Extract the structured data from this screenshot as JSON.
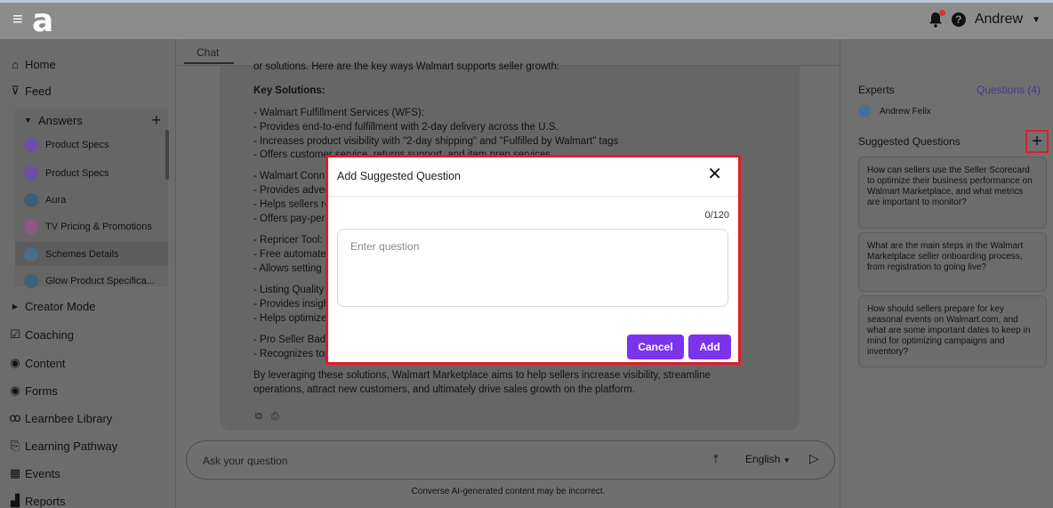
{
  "header": {
    "logo": "a",
    "user_name": "Andrew"
  },
  "sidebar": {
    "items": [
      {
        "label": "Home",
        "icon": "home-icon"
      },
      {
        "label": "Feed",
        "icon": "feed-icon"
      }
    ],
    "answers": {
      "label": "Answers",
      "items": [
        {
          "label": "Product Specs"
        },
        {
          "label": "Product Specs"
        },
        {
          "label": "Aura"
        },
        {
          "label": "TV Pricing & Promotions"
        },
        {
          "label": "Schemes Details"
        },
        {
          "label": "Glow Product Specifica..."
        }
      ]
    },
    "lower_items": [
      {
        "label": "Creator Mode",
        "icon": "caret-right-icon"
      },
      {
        "label": "Coaching",
        "icon": "checkbox-icon"
      },
      {
        "label": "Content",
        "icon": "content-icon"
      },
      {
        "label": "Forms",
        "icon": "forms-icon"
      },
      {
        "label": "Learnbee Library",
        "icon": "library-icon"
      },
      {
        "label": "Learning Pathway",
        "icon": "pathway-icon"
      },
      {
        "label": "Events",
        "icon": "calendar-icon"
      },
      {
        "label": "Reports",
        "icon": "reports-icon"
      }
    ]
  },
  "chat": {
    "tab_label": "Chat",
    "lines": [
      "or solutions. Here are the key ways Walmart supports seller growth:",
      "Key Solutions:",
      "- Walmart Fulfillment Services (WFS):",
      "- Provides end-to-end fulfillment with 2-day delivery across the U.S.",
      "- Increases product visibility with \"2-day shipping\" and \"Fulfilled by Walmart\" tags",
      "- Offers customer service, returns support, and item prep services",
      "- Walmart Conn",
      "- Provides adver",
      "- Helps sellers re",
      "- Offers pay-per-",
      "- Repricer Tool:",
      "- Free automate",
      "- Allows setting",
      "- Listing Quality",
      "- Provides insigh",
      "- Helps optimize",
      "- Pro Seller Badg",
      "- Recognizes top",
      "By leveraging these solutions, Walmart Marketplace aims to help sellers increase visibility, streamline",
      "operations, attract new customers, and ultimately drive sales growth on the platform."
    ],
    "ask_placeholder": "Ask your question",
    "language": "English",
    "disclaimer": "Converse AI-generated content may be incorrect."
  },
  "right_panel": {
    "experts_label": "Experts",
    "questions_link": "Questions (4)",
    "expert_name": "Andrew Felix",
    "suggested_label": "Suggested Questions",
    "questions": [
      "How can sellers use the Seller Scorecard to optimize their business performance on Walmart Marketplace, and what metrics are important to monitor?",
      "What are the main steps in the Walmart Marketplace seller onboarding process, from registration to going live?",
      "How should sellers prepare for key seasonal events on Walmart.com, and what are some important dates to keep in mind for optimizing campaigns and inventory?"
    ]
  },
  "modal": {
    "title": "Add Suggested Question",
    "counter": "0/120",
    "placeholder": "Enter question",
    "cancel_label": "Cancel",
    "add_label": "Add"
  }
}
